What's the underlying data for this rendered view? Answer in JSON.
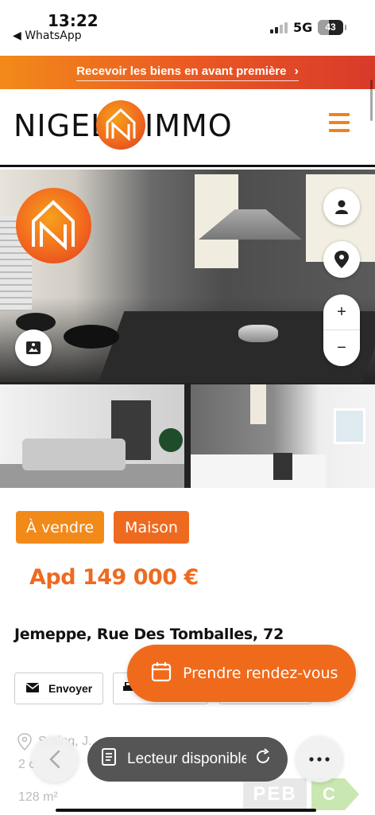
{
  "status_bar": {
    "time": "13:22",
    "back_app": "◀ WhatsApp",
    "network": "5G",
    "battery": "43"
  },
  "promo": {
    "text": "Recevoir les biens en avant première",
    "chevron": "›"
  },
  "header": {
    "brand_left": "NIGEL",
    "brand_right": "IMMO",
    "menu_icon": "hamburger-icon"
  },
  "gallery": {
    "map_controls": {
      "agent_icon": "person-icon",
      "location_icon": "location-pin-icon",
      "zoom_in": "+",
      "zoom_out": "−"
    },
    "pano_icon": "panorama-icon"
  },
  "listing": {
    "tags": [
      "À vendre",
      "Maison"
    ],
    "price": "Apd 149 000 €",
    "address": "Jemeppe, Rue Des Tomballes, 72",
    "actions": {
      "send_label": "Envoyer"
    },
    "appointment_label": "Prendre rendez-vous",
    "details": {
      "line1": "Sraing, J...",
      "line2": "2 c...   re",
      "area": "128 m²"
    },
    "peb": {
      "label": "PEB",
      "rating": "C"
    }
  },
  "browser": {
    "reader_label": "Lecteur disponible",
    "back_icon": "chevron-left-icon",
    "more_icon": "ellipsis-icon"
  },
  "colors": {
    "orange": "#f28a1a",
    "orange_dark": "#ee6a1f",
    "red": "#d83a2a"
  }
}
